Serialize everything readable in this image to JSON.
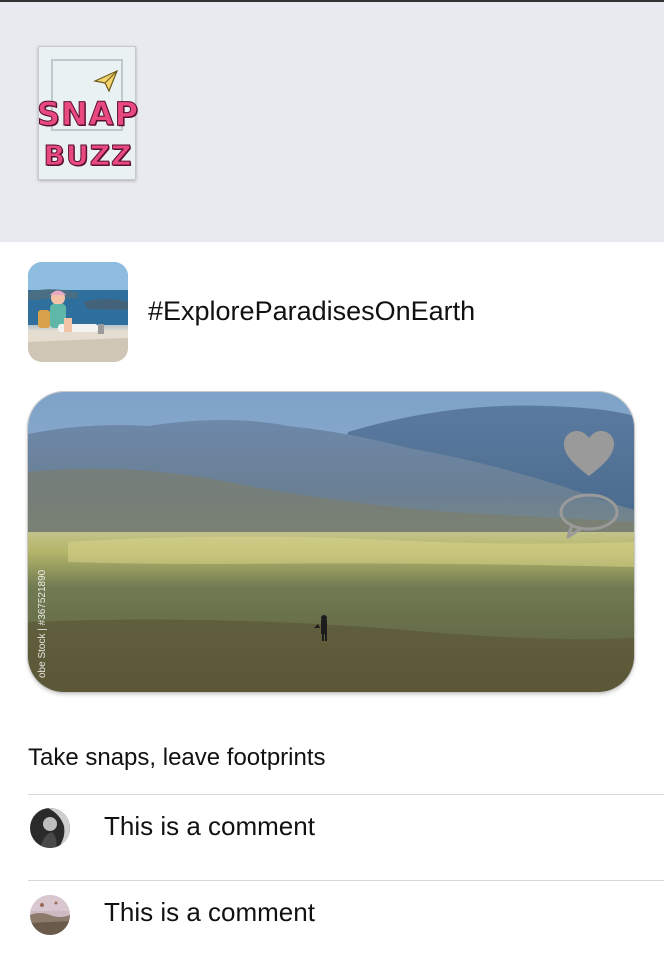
{
  "app": {
    "logo_line1": "SNAP",
    "logo_line2": "BUZZ"
  },
  "post": {
    "hashtag": "#ExploreParadisesOnEarth",
    "watermark": "obe Stock | #367521890",
    "caption": "Take snaps, leave footprints",
    "actions": {
      "like_icon": "heart-icon",
      "comment_icon": "speech-bubble-icon"
    }
  },
  "comments": [
    {
      "text": "This is a comment"
    },
    {
      "text": "This is a comment"
    }
  ],
  "colors": {
    "header_bg": "#e9e9f0",
    "logo_pink": "#e84a7f",
    "icon_gray": "#9a9a9a",
    "divider": "#d8d8d8"
  }
}
